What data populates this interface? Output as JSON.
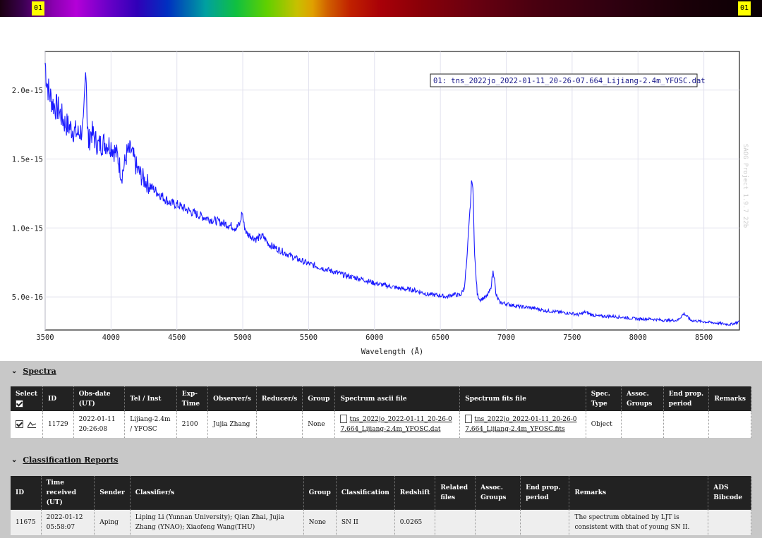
{
  "strip": {
    "left_tag": "01",
    "right_tag": "01"
  },
  "chart_data": {
    "type": "line",
    "xlabel": "Wavelength (Å)",
    "ylabel": "",
    "xlim": [
      3500,
      8770
    ],
    "ylim": [
      2.6e-16,
      2.28e-15
    ],
    "x_ticks": [
      "3500",
      "4000",
      "4500",
      "5000",
      "5500",
      "6000",
      "6500",
      "7000",
      "7500",
      "8000",
      "8500"
    ],
    "y_ticks": [
      "5.0e-16",
      "1.0e-15",
      "1.5e-15",
      "2.0e-15"
    ],
    "legend": "01: tns_2022jo_2022-01-11_20-26-07.664_Lijiang-2.4m_YFOSC.dat",
    "watermark": "SAOG Project 1.9.7 22b",
    "series": [
      {
        "color": "#1a1aff",
        "x": [
          3500,
          3510,
          3530,
          3560,
          3600,
          3650,
          3700,
          3750,
          3790,
          3800,
          3810,
          3815,
          3820,
          3830,
          3850,
          3900,
          3950,
          4000,
          4050,
          4080,
          4100,
          4120,
          4150,
          4180,
          4200,
          4250,
          4300,
          4350,
          4400,
          4450,
          4500,
          4600,
          4700,
          4800,
          4900,
          4950,
          4980,
          4995,
          5010,
          5030,
          5100,
          5150,
          5170,
          5200,
          5300,
          5400,
          5500,
          5600,
          5700,
          5800,
          5900,
          6000,
          6100,
          6200,
          6300,
          6400,
          6500,
          6550,
          6600,
          6650,
          6680,
          6700,
          6720,
          6740,
          6750,
          6760,
          6780,
          6800,
          6850,
          6880,
          6900,
          6910,
          6920,
          6950,
          7000,
          7100,
          7200,
          7300,
          7400,
          7500,
          7550,
          7600,
          7650,
          7700,
          7800,
          7900,
          8000,
          8100,
          8200,
          8300,
          8350,
          8400,
          8500,
          8600,
          8700,
          8770
        ],
        "y": [
          2.2e-15,
          2.08e-15,
          1.98e-15,
          1.9e-15,
          1.86e-15,
          1.76e-15,
          1.72e-15,
          1.68e-15,
          1.72e-15,
          1.95e-15,
          2.2e-15,
          1.98e-15,
          1.74e-15,
          1.62e-15,
          1.7e-15,
          1.6e-15,
          1.62e-15,
          1.6e-15,
          1.52e-15,
          1.38e-15,
          1.45e-15,
          1.54e-15,
          1.56e-15,
          1.48e-15,
          1.42e-15,
          1.35e-15,
          1.3e-15,
          1.26e-15,
          1.22e-15,
          1.18e-15,
          1.17e-15,
          1.12e-15,
          1.08e-15,
          1.05e-15,
          1.02e-15,
          1e-15,
          1.03e-15,
          1.12e-15,
          1.02e-15,
          9.6e-16,
          9.2e-16,
          9.4e-16,
          9.2e-16,
          8.8e-16,
          8.3e-16,
          7.8e-16,
          7.4e-16,
          7.1e-16,
          6.8e-16,
          6.5e-16,
          6.3e-16,
          6e-16,
          5.8e-16,
          5.6e-16,
          5.5e-16,
          5.2e-16,
          5.1e-16,
          5e-16,
          5.2e-16,
          5.1e-16,
          5.6e-16,
          7.5e-16,
          1.05e-15,
          1.37e-15,
          1.2e-15,
          8e-16,
          5.2e-16,
          4.8e-16,
          5e-16,
          5.5e-16,
          6.8e-16,
          6.5e-16,
          5.2e-16,
          4.6e-16,
          4.5e-16,
          4.3e-16,
          4.2e-16,
          4e-16,
          3.9e-16,
          3.8e-16,
          3.7e-16,
          3.9e-16,
          3.7e-16,
          3.6e-16,
          3.6e-16,
          3.5e-16,
          3.4e-16,
          3.4e-16,
          3.3e-16,
          3.3e-16,
          3.8e-16,
          3.3e-16,
          3.2e-16,
          3.1e-16,
          3e-16,
          3.2e-16
        ]
      }
    ]
  },
  "spectra": {
    "heading": "Spectra",
    "columns": [
      "Select",
      "ID",
      "Obs-date (UT)",
      "Tel / Inst",
      "Exp-Time",
      "Observer/s",
      "Reducer/s",
      "Group",
      "Spectrum ascii file",
      "Spectrum fits file",
      "Spec. Type",
      "Assoc. Groups",
      "End prop. period",
      "Remarks"
    ],
    "row": {
      "id": "11729",
      "obs_date": "2022-01-11 20:26:08",
      "tel_inst": "Lijiang-2.4m / YFOSC",
      "exp_time": "2100",
      "observers": "Jujia Zhang",
      "reducers": "",
      "group": "None",
      "ascii_file": "tns_2022jo_2022-01-11_20-26-07.664_Lijiang-2.4m_YFOSC.dat",
      "fits_file": "tns_2022jo_2022-01-11_20-26-07.664_Lijiang-2.4m_YFOSC.fits",
      "spec_type": "Object",
      "assoc_groups": "",
      "end_prop": "",
      "remarks": ""
    }
  },
  "classification": {
    "heading": "Classification Reports",
    "columns": [
      "ID",
      "Time received (UT)",
      "Sender",
      "Classifier/s",
      "Group",
      "Classification",
      "Redshift",
      "Related files",
      "Assoc. Groups",
      "End prop. period",
      "Remarks",
      "ADS Bibcode"
    ],
    "row": {
      "id": "11675",
      "time_received": "2022-01-12 05:58:07",
      "sender": "Aping",
      "classifiers": "Liping Li (Yunnan University); Qian Zhai, Jujia Zhang (YNAO); Xiaofeng Wang(THU)",
      "group": "None",
      "classification": "SN II",
      "redshift": "0.0265",
      "related_files": "",
      "assoc_groups": "",
      "end_prop": "",
      "remarks": "The spectrum obtained by LJT is consistent with that of young SN II.",
      "ads_bibcode": ""
    }
  }
}
